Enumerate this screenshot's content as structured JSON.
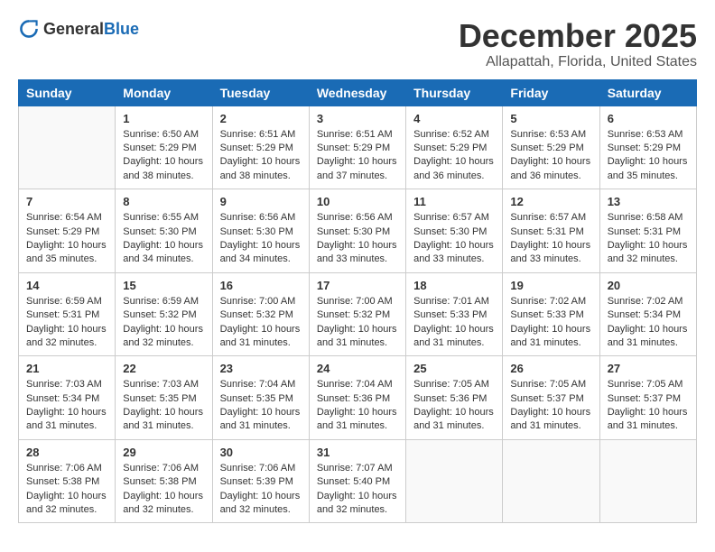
{
  "logo": {
    "general": "General",
    "blue": "Blue"
  },
  "title": "December 2025",
  "location": "Allapattah, Florida, United States",
  "headers": [
    "Sunday",
    "Monday",
    "Tuesday",
    "Wednesday",
    "Thursday",
    "Friday",
    "Saturday"
  ],
  "weeks": [
    [
      {
        "day": "",
        "sunrise": "",
        "sunset": "",
        "daylight": ""
      },
      {
        "day": "1",
        "sunrise": "Sunrise: 6:50 AM",
        "sunset": "Sunset: 5:29 PM",
        "daylight": "Daylight: 10 hours and 38 minutes."
      },
      {
        "day": "2",
        "sunrise": "Sunrise: 6:51 AM",
        "sunset": "Sunset: 5:29 PM",
        "daylight": "Daylight: 10 hours and 38 minutes."
      },
      {
        "day": "3",
        "sunrise": "Sunrise: 6:51 AM",
        "sunset": "Sunset: 5:29 PM",
        "daylight": "Daylight: 10 hours and 37 minutes."
      },
      {
        "day": "4",
        "sunrise": "Sunrise: 6:52 AM",
        "sunset": "Sunset: 5:29 PM",
        "daylight": "Daylight: 10 hours and 36 minutes."
      },
      {
        "day": "5",
        "sunrise": "Sunrise: 6:53 AM",
        "sunset": "Sunset: 5:29 PM",
        "daylight": "Daylight: 10 hours and 36 minutes."
      },
      {
        "day": "6",
        "sunrise": "Sunrise: 6:53 AM",
        "sunset": "Sunset: 5:29 PM",
        "daylight": "Daylight: 10 hours and 35 minutes."
      }
    ],
    [
      {
        "day": "7",
        "sunrise": "Sunrise: 6:54 AM",
        "sunset": "Sunset: 5:29 PM",
        "daylight": "Daylight: 10 hours and 35 minutes."
      },
      {
        "day": "8",
        "sunrise": "Sunrise: 6:55 AM",
        "sunset": "Sunset: 5:30 PM",
        "daylight": "Daylight: 10 hours and 34 minutes."
      },
      {
        "day": "9",
        "sunrise": "Sunrise: 6:56 AM",
        "sunset": "Sunset: 5:30 PM",
        "daylight": "Daylight: 10 hours and 34 minutes."
      },
      {
        "day": "10",
        "sunrise": "Sunrise: 6:56 AM",
        "sunset": "Sunset: 5:30 PM",
        "daylight": "Daylight: 10 hours and 33 minutes."
      },
      {
        "day": "11",
        "sunrise": "Sunrise: 6:57 AM",
        "sunset": "Sunset: 5:30 PM",
        "daylight": "Daylight: 10 hours and 33 minutes."
      },
      {
        "day": "12",
        "sunrise": "Sunrise: 6:57 AM",
        "sunset": "Sunset: 5:31 PM",
        "daylight": "Daylight: 10 hours and 33 minutes."
      },
      {
        "day": "13",
        "sunrise": "Sunrise: 6:58 AM",
        "sunset": "Sunset: 5:31 PM",
        "daylight": "Daylight: 10 hours and 32 minutes."
      }
    ],
    [
      {
        "day": "14",
        "sunrise": "Sunrise: 6:59 AM",
        "sunset": "Sunset: 5:31 PM",
        "daylight": "Daylight: 10 hours and 32 minutes."
      },
      {
        "day": "15",
        "sunrise": "Sunrise: 6:59 AM",
        "sunset": "Sunset: 5:32 PM",
        "daylight": "Daylight: 10 hours and 32 minutes."
      },
      {
        "day": "16",
        "sunrise": "Sunrise: 7:00 AM",
        "sunset": "Sunset: 5:32 PM",
        "daylight": "Daylight: 10 hours and 31 minutes."
      },
      {
        "day": "17",
        "sunrise": "Sunrise: 7:00 AM",
        "sunset": "Sunset: 5:32 PM",
        "daylight": "Daylight: 10 hours and 31 minutes."
      },
      {
        "day": "18",
        "sunrise": "Sunrise: 7:01 AM",
        "sunset": "Sunset: 5:33 PM",
        "daylight": "Daylight: 10 hours and 31 minutes."
      },
      {
        "day": "19",
        "sunrise": "Sunrise: 7:02 AM",
        "sunset": "Sunset: 5:33 PM",
        "daylight": "Daylight: 10 hours and 31 minutes."
      },
      {
        "day": "20",
        "sunrise": "Sunrise: 7:02 AM",
        "sunset": "Sunset: 5:34 PM",
        "daylight": "Daylight: 10 hours and 31 minutes."
      }
    ],
    [
      {
        "day": "21",
        "sunrise": "Sunrise: 7:03 AM",
        "sunset": "Sunset: 5:34 PM",
        "daylight": "Daylight: 10 hours and 31 minutes."
      },
      {
        "day": "22",
        "sunrise": "Sunrise: 7:03 AM",
        "sunset": "Sunset: 5:35 PM",
        "daylight": "Daylight: 10 hours and 31 minutes."
      },
      {
        "day": "23",
        "sunrise": "Sunrise: 7:04 AM",
        "sunset": "Sunset: 5:35 PM",
        "daylight": "Daylight: 10 hours and 31 minutes."
      },
      {
        "day": "24",
        "sunrise": "Sunrise: 7:04 AM",
        "sunset": "Sunset: 5:36 PM",
        "daylight": "Daylight: 10 hours and 31 minutes."
      },
      {
        "day": "25",
        "sunrise": "Sunrise: 7:05 AM",
        "sunset": "Sunset: 5:36 PM",
        "daylight": "Daylight: 10 hours and 31 minutes."
      },
      {
        "day": "26",
        "sunrise": "Sunrise: 7:05 AM",
        "sunset": "Sunset: 5:37 PM",
        "daylight": "Daylight: 10 hours and 31 minutes."
      },
      {
        "day": "27",
        "sunrise": "Sunrise: 7:05 AM",
        "sunset": "Sunset: 5:37 PM",
        "daylight": "Daylight: 10 hours and 31 minutes."
      }
    ],
    [
      {
        "day": "28",
        "sunrise": "Sunrise: 7:06 AM",
        "sunset": "Sunset: 5:38 PM",
        "daylight": "Daylight: 10 hours and 32 minutes."
      },
      {
        "day": "29",
        "sunrise": "Sunrise: 7:06 AM",
        "sunset": "Sunset: 5:38 PM",
        "daylight": "Daylight: 10 hours and 32 minutes."
      },
      {
        "day": "30",
        "sunrise": "Sunrise: 7:06 AM",
        "sunset": "Sunset: 5:39 PM",
        "daylight": "Daylight: 10 hours and 32 minutes."
      },
      {
        "day": "31",
        "sunrise": "Sunrise: 7:07 AM",
        "sunset": "Sunset: 5:40 PM",
        "daylight": "Daylight: 10 hours and 32 minutes."
      },
      {
        "day": "",
        "sunrise": "",
        "sunset": "",
        "daylight": ""
      },
      {
        "day": "",
        "sunrise": "",
        "sunset": "",
        "daylight": ""
      },
      {
        "day": "",
        "sunrise": "",
        "sunset": "",
        "daylight": ""
      }
    ]
  ]
}
